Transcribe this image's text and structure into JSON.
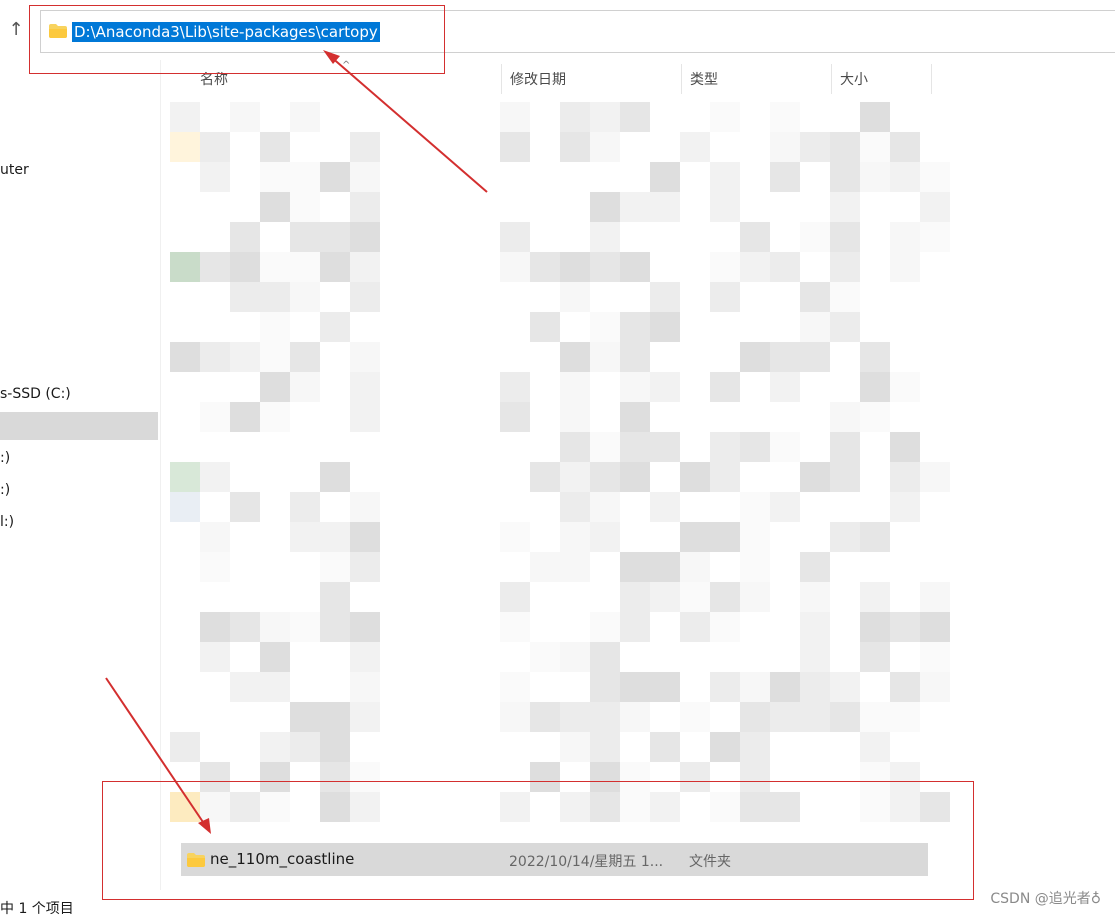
{
  "toolbar": {
    "up_icon": "up-arrow-icon"
  },
  "address_bar": {
    "path": "D:\\Anaconda3\\Lib\\site-packages\\cartopy",
    "icon": "folder-icon"
  },
  "columns": [
    {
      "label": "名称"
    },
    {
      "label": "修改日期"
    },
    {
      "label": "类型"
    },
    {
      "label": "大小"
    }
  ],
  "nav_pane": {
    "items": [
      {
        "label": "uter"
      },
      {
        "label": "s-SSD (C:)"
      },
      {
        "label": ":)"
      },
      {
        "label": ":)"
      },
      {
        "label": "l:)"
      }
    ]
  },
  "highlighted_row": {
    "name": "ne_110m_coastline",
    "date": "2022/10/14/星期五 1...",
    "type": "文件夹",
    "icon": "folder-icon"
  },
  "status_bar": {
    "text": "中 1 个项目"
  },
  "watermark": {
    "text": "CSDN @追光者♁"
  },
  "colors": {
    "selection": "#0078d7",
    "annotation": "#d32f2f",
    "row_highlight": "#d9d9d9",
    "folder": "#f8d35e"
  }
}
